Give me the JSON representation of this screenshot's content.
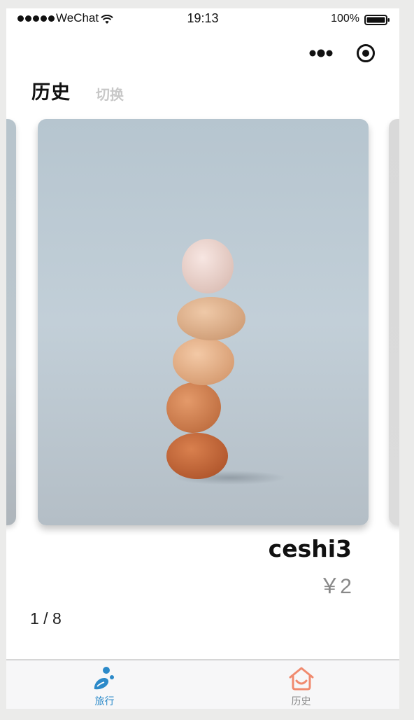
{
  "status_bar": {
    "carrier": "WeChat",
    "time": "19:13",
    "battery": "100%",
    "signal_icon": "signal-dots-icon",
    "wifi_icon": "wifi-icon",
    "battery_icon": "battery-icon"
  },
  "capsule": {
    "more_icon": "more-dots-icon",
    "close_icon": "target-close-icon"
  },
  "header": {
    "active_tab": "历史",
    "switch_tab": "切换"
  },
  "carousel": {
    "current_item": {
      "name": "ceshi3",
      "price": "￥2",
      "image_icon": "stacked-eggs-photo"
    },
    "pager": "1 / 8",
    "current_index": 1,
    "total": 8
  },
  "tabbar": {
    "items": [
      {
        "label": "旅行",
        "icon": "travel-icon",
        "active": true
      },
      {
        "label": "历史",
        "icon": "history-house-icon",
        "active": false
      }
    ],
    "active_color": "#2c8ac9",
    "inactive_color": "#8a8a8a",
    "history_icon_color": "#f08a6e"
  }
}
